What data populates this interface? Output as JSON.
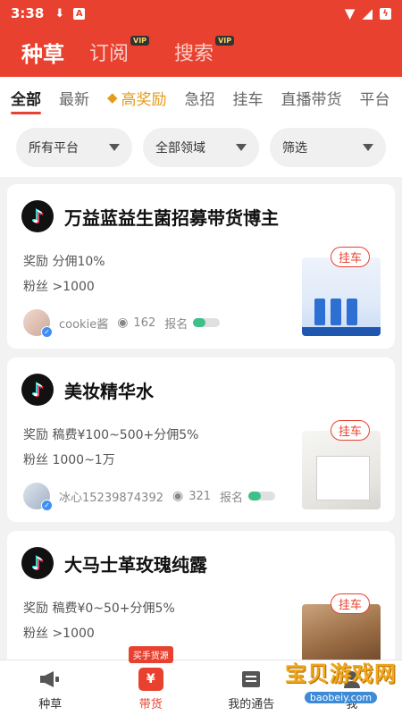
{
  "status_bar": {
    "time": "3:38"
  },
  "header": {
    "tabs": [
      {
        "label": "种草",
        "vip": ""
      },
      {
        "label": "订阅",
        "vip": "VIP"
      },
      {
        "label": "搜索",
        "vip": "VIP"
      }
    ]
  },
  "categories": [
    "全部",
    "最新",
    "高奖励",
    "急招",
    "挂车",
    "直播带货",
    "平台"
  ],
  "filters": [
    "所有平台",
    "全部领域",
    "筛选"
  ],
  "cards": [
    {
      "title": "万益蓝益生菌招募带货博主",
      "reward": "奖励 分佣10%",
      "fans": "粉丝 >1000",
      "user": "cookie酱",
      "views": "162",
      "signup": "报名",
      "tag": "挂车",
      "progress": 0.5
    },
    {
      "title": "美妆精华水",
      "reward": "奖励 稿费¥100~500+分佣5%",
      "fans": "粉丝 1000~1万",
      "user": "冰心15239874392",
      "views": "321",
      "signup": "报名",
      "tag": "挂车",
      "progress": 0.5
    },
    {
      "title": "大马士革玫瑰纯露",
      "reward": "奖励 稿费¥0~50+分佣5%",
      "fans": "粉丝 >1000",
      "tag": "挂车"
    }
  ],
  "bottom_nav": {
    "items": [
      "种草",
      "带货",
      "我的通告",
      "我"
    ],
    "hot_badge": "买手货源"
  },
  "watermark": {
    "cn": "宝贝游戏网",
    "en": "baobeiy.com"
  },
  "colors": {
    "brand": "#e9412f",
    "gold": "#e39b1e",
    "toggle": "#3ec08b"
  }
}
